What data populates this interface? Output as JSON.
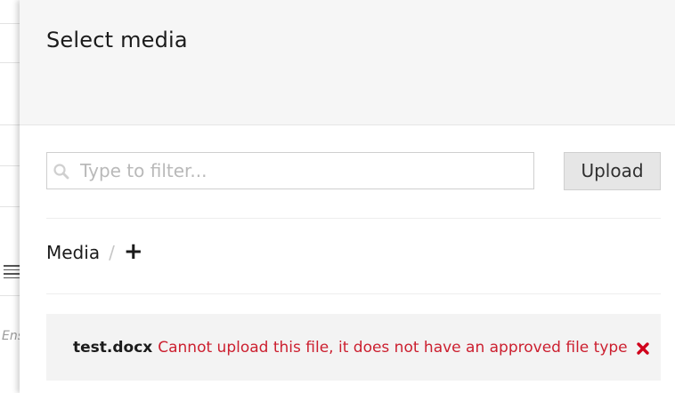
{
  "dialog": {
    "title": "Select media"
  },
  "search": {
    "placeholder": "Type to filter...",
    "value": ""
  },
  "toolbar": {
    "upload_label": "Upload"
  },
  "breadcrumb": {
    "root_label": "Media",
    "separator": "/",
    "add_label": "+"
  },
  "error": {
    "file_name": "test.docx",
    "message": "Cannot upload this file, it does not have an approved file type",
    "icon": "close-icon"
  },
  "background": {
    "fragment_text": "Ensu"
  },
  "colors": {
    "header_background": "#f6f6f6",
    "error_text": "#cc1f2f",
    "error_icon": "#d0021b",
    "upload_button_background": "#e6e6e6",
    "error_box_background": "#f3f3f3"
  }
}
